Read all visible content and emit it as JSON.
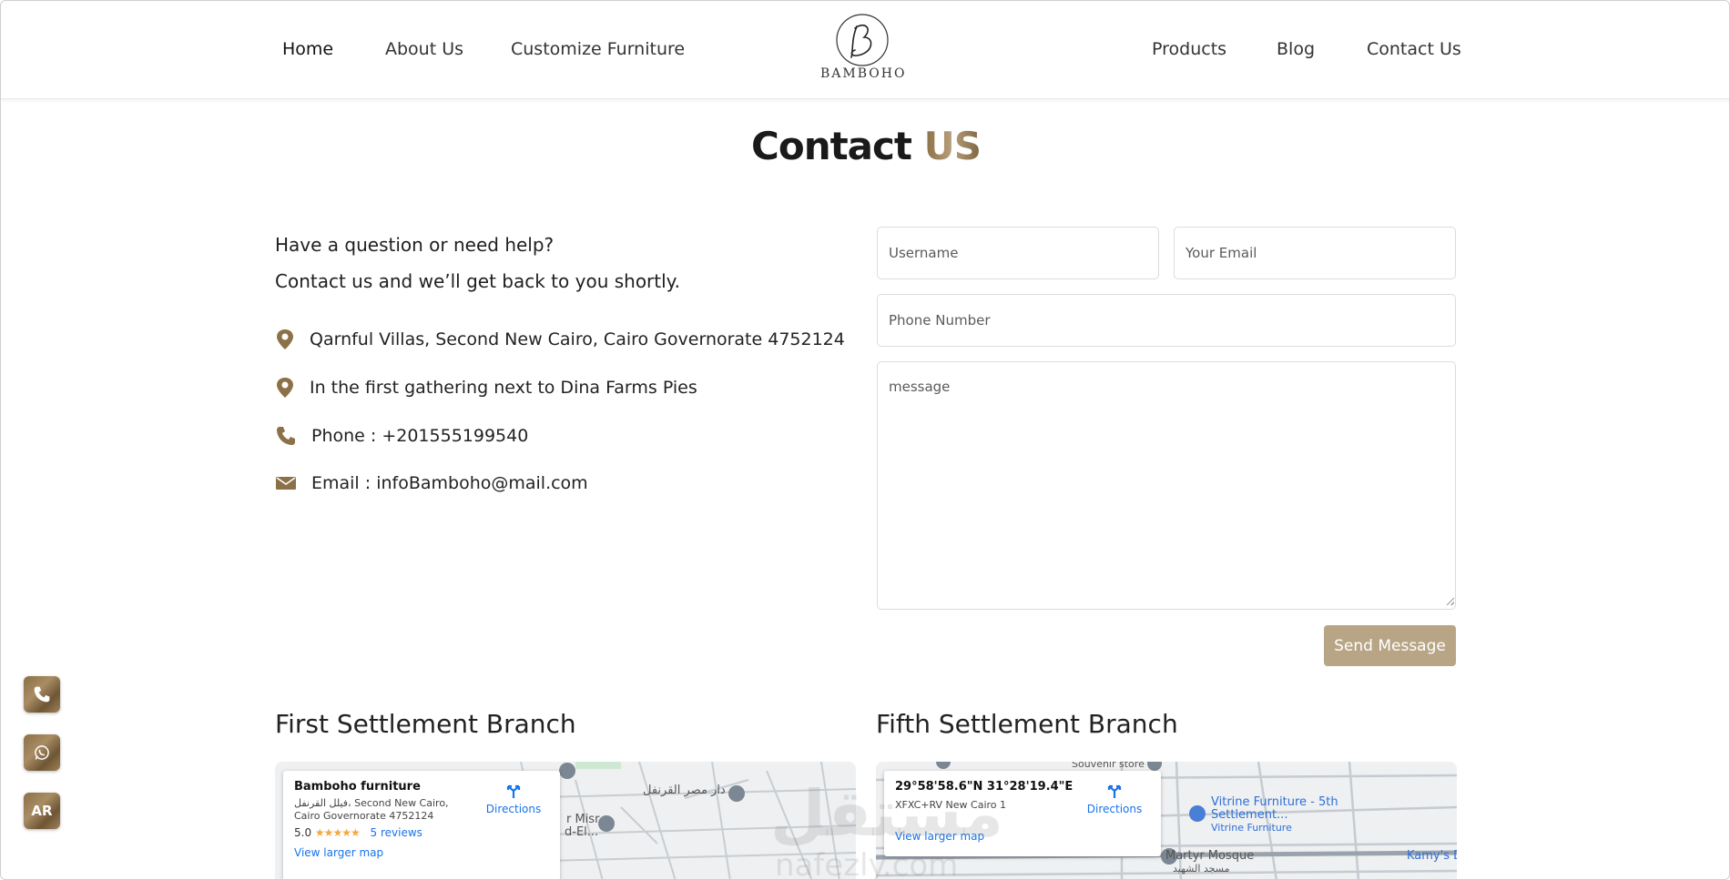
{
  "nav": {
    "left": [
      "Home",
      "About Us",
      "Customize Furniture"
    ],
    "right": [
      "Products",
      "Blog",
      "Contact Us"
    ],
    "logo_text": "BAMBOHO"
  },
  "title": {
    "main": "Contact",
    "accent": "US"
  },
  "intro": {
    "line1": "Have a question or need help?",
    "line2": "Contact us and we’ll get back to you shortly."
  },
  "info": {
    "address": "Qarnful Villas, Second New Cairo, Cairo Governorate 4752124",
    "landmark": "In the first gathering next to Dina Farms Pies",
    "phone": "Phone : +201555199540",
    "email": "Email : infoBamboho@mail.com"
  },
  "form": {
    "username_placeholder": "Username",
    "email_placeholder": "Your Email",
    "phone_placeholder": "Phone Number",
    "message_placeholder": "message",
    "send_label": "Send Message"
  },
  "branches": {
    "first": {
      "title": "First Settlement Branch",
      "card_name": "Bamboho furniture",
      "card_address": "فيلل القرنفل، Second New Cairo, Cairo Governorate 4752124",
      "rating": "5.0",
      "stars": "★★★★★",
      "reviews": "5 reviews",
      "directions": "Directions",
      "larger_map": "View larger map",
      "label_dar": "دار مصر القرنفل",
      "label_misr": "r Misr",
      "label_el": "d-El..."
    },
    "fifth": {
      "title": "Fifth Settlement Branch",
      "card_name": "29°58'58.6\"N 31°28'19.4\"E",
      "card_address": "XFXC+RV New Cairo 1",
      "directions": "Directions",
      "larger_map": "View larger map",
      "label_vitrine": "Vitrine Furniture - 5th Settlement...",
      "label_vitrine_sub": "Vitrine Furniture",
      "label_mosque": "Martyr Mosque",
      "label_mosque_ar": "مسجد الشهيد",
      "label_kamy": "Kamy's D",
      "label_souvenir": "Souvenir store"
    }
  },
  "floating": {
    "phone_icon": "phone-icon",
    "whatsapp_icon": "whatsapp-icon",
    "lang": "AR"
  },
  "watermark": {
    "arabic": "مستقل",
    "latin": "nafezly.com"
  },
  "colors": {
    "accent": "#9a8155",
    "button": "#b8a586",
    "link": "#1a73e8"
  }
}
